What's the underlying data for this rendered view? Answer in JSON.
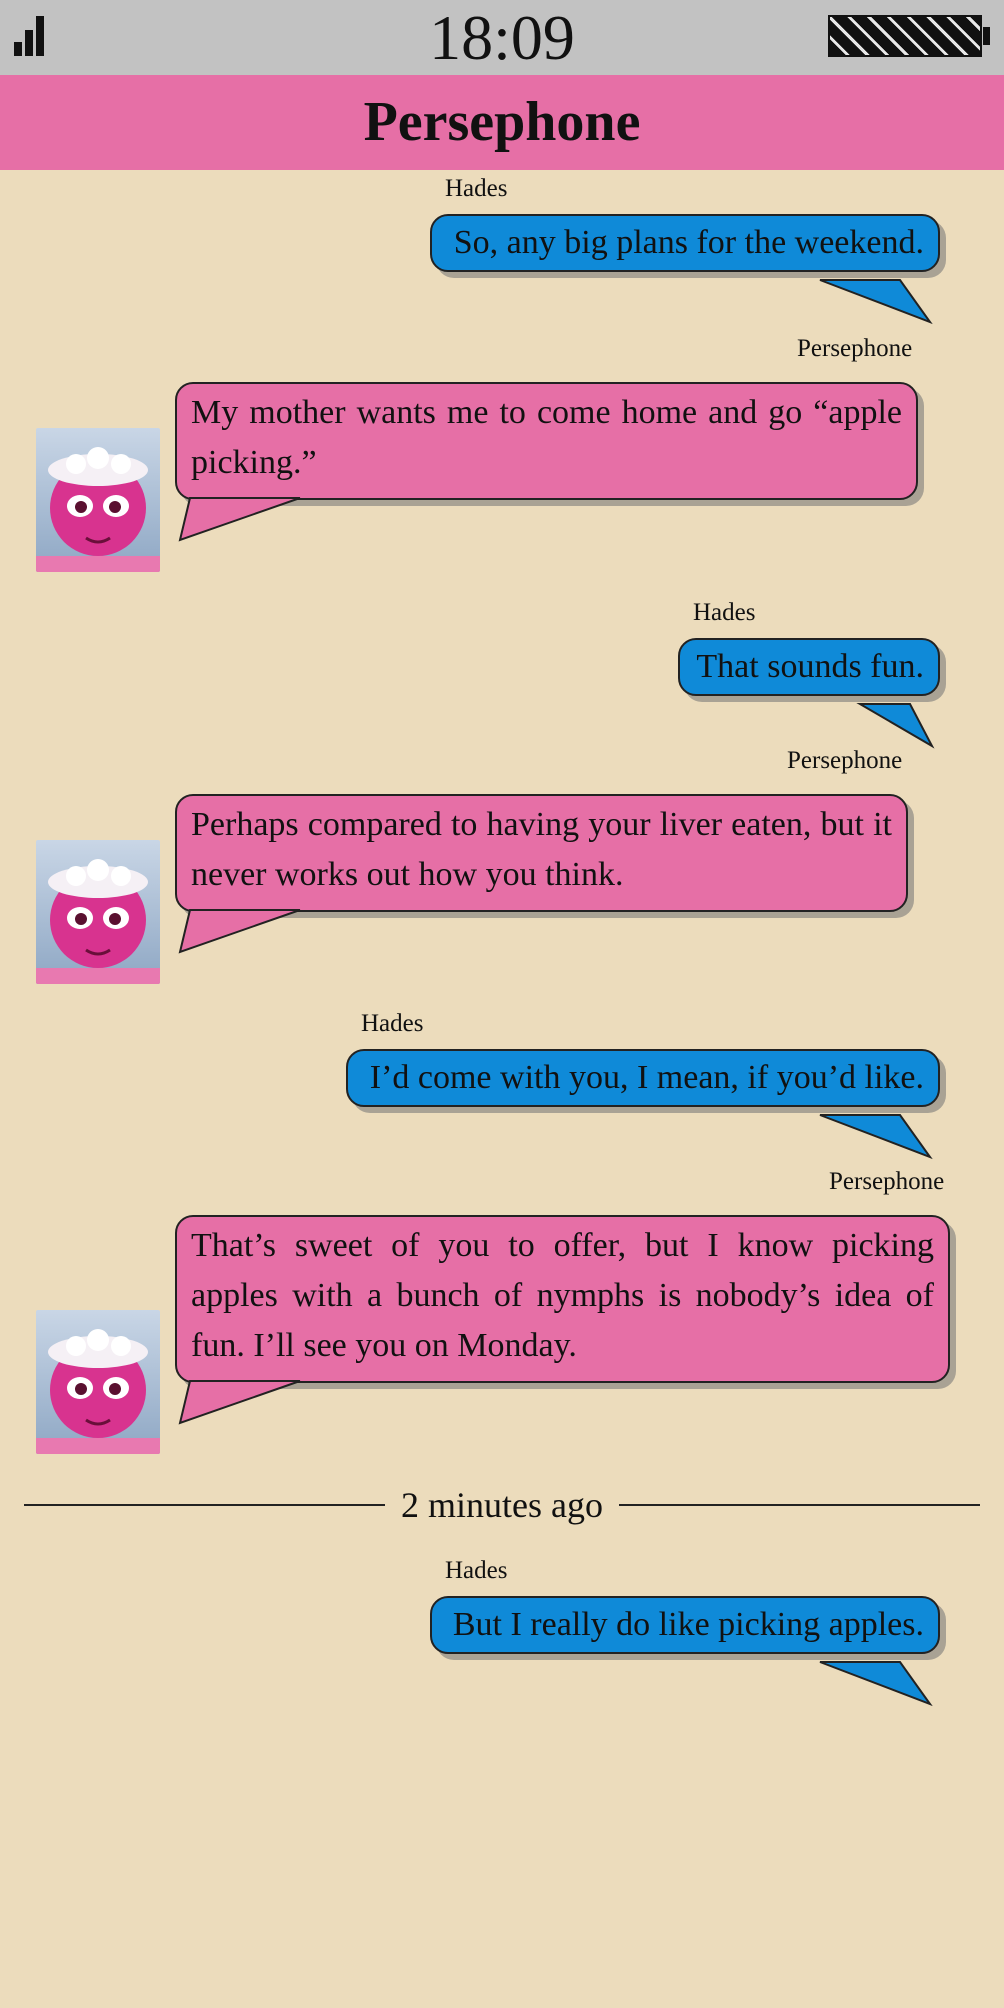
{
  "status_bar": {
    "time": "18:09"
  },
  "header": {
    "contact_name": "Persephone"
  },
  "messages": [
    {
      "sender": "Hades",
      "text": "So, any big plans for the weekend."
    },
    {
      "sender": "Persephone",
      "text": "My mother wants me to come home and go “apple picking.”"
    },
    {
      "sender": "Hades",
      "text": "That sounds fun."
    },
    {
      "sender": "Persephone",
      "text": "Perhaps compared to having your liver eaten, but it never works out how you think."
    },
    {
      "sender": "Hades",
      "text": "I’d come with you, I mean, if you’d like."
    },
    {
      "sender": "Persephone",
      "text": "That’s sweet of you to offer, but I know picking apples with a bunch of nymphs is nobody’s idea of fun.  I’ll see you on Monday."
    },
    {
      "sender": "Hades",
      "text": "But I really do like picking apples."
    }
  ],
  "divider": {
    "label": "2 minutes ago"
  },
  "colors": {
    "outgoing": "#0f8ad8",
    "incoming": "#e66fa6",
    "background": "#ecdcbc",
    "status_bar": "#c2c2c2"
  },
  "icons": [
    "signal-icon",
    "battery-icon",
    "persephone-avatar"
  ]
}
